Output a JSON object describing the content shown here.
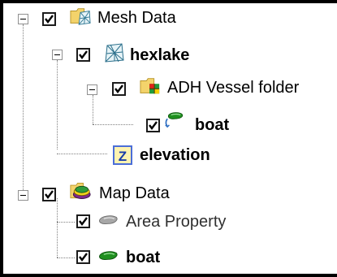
{
  "tree": {
    "mesh_data": {
      "label": "Mesh Data",
      "icon": "mesh-folder-icon",
      "checked": true,
      "expanded": true
    },
    "hexlake": {
      "label": "hexlake",
      "icon": "mesh-icon",
      "checked": true,
      "expanded": true
    },
    "adh_folder": {
      "label": "ADH Vessel folder",
      "icon": "vessel-folder-icon",
      "checked": true,
      "expanded": true
    },
    "boat_mesh": {
      "label": "boat",
      "icon": "boat-vessel-icon",
      "checked": true
    },
    "elevation": {
      "label": "elevation",
      "icon": "z-dataset-icon"
    },
    "map_data": {
      "label": "Map Data",
      "icon": "map-folder-icon",
      "checked": true,
      "expanded": true
    },
    "area_property": {
      "label": "Area Property",
      "icon": "gray-coverage-icon",
      "checked": true
    },
    "boat_map": {
      "label": "boat",
      "icon": "green-coverage-icon",
      "checked": true
    }
  },
  "colors": {
    "checkbox_border": "#1c1c1c",
    "tree_lines": "#808080",
    "selection": "#000000"
  }
}
